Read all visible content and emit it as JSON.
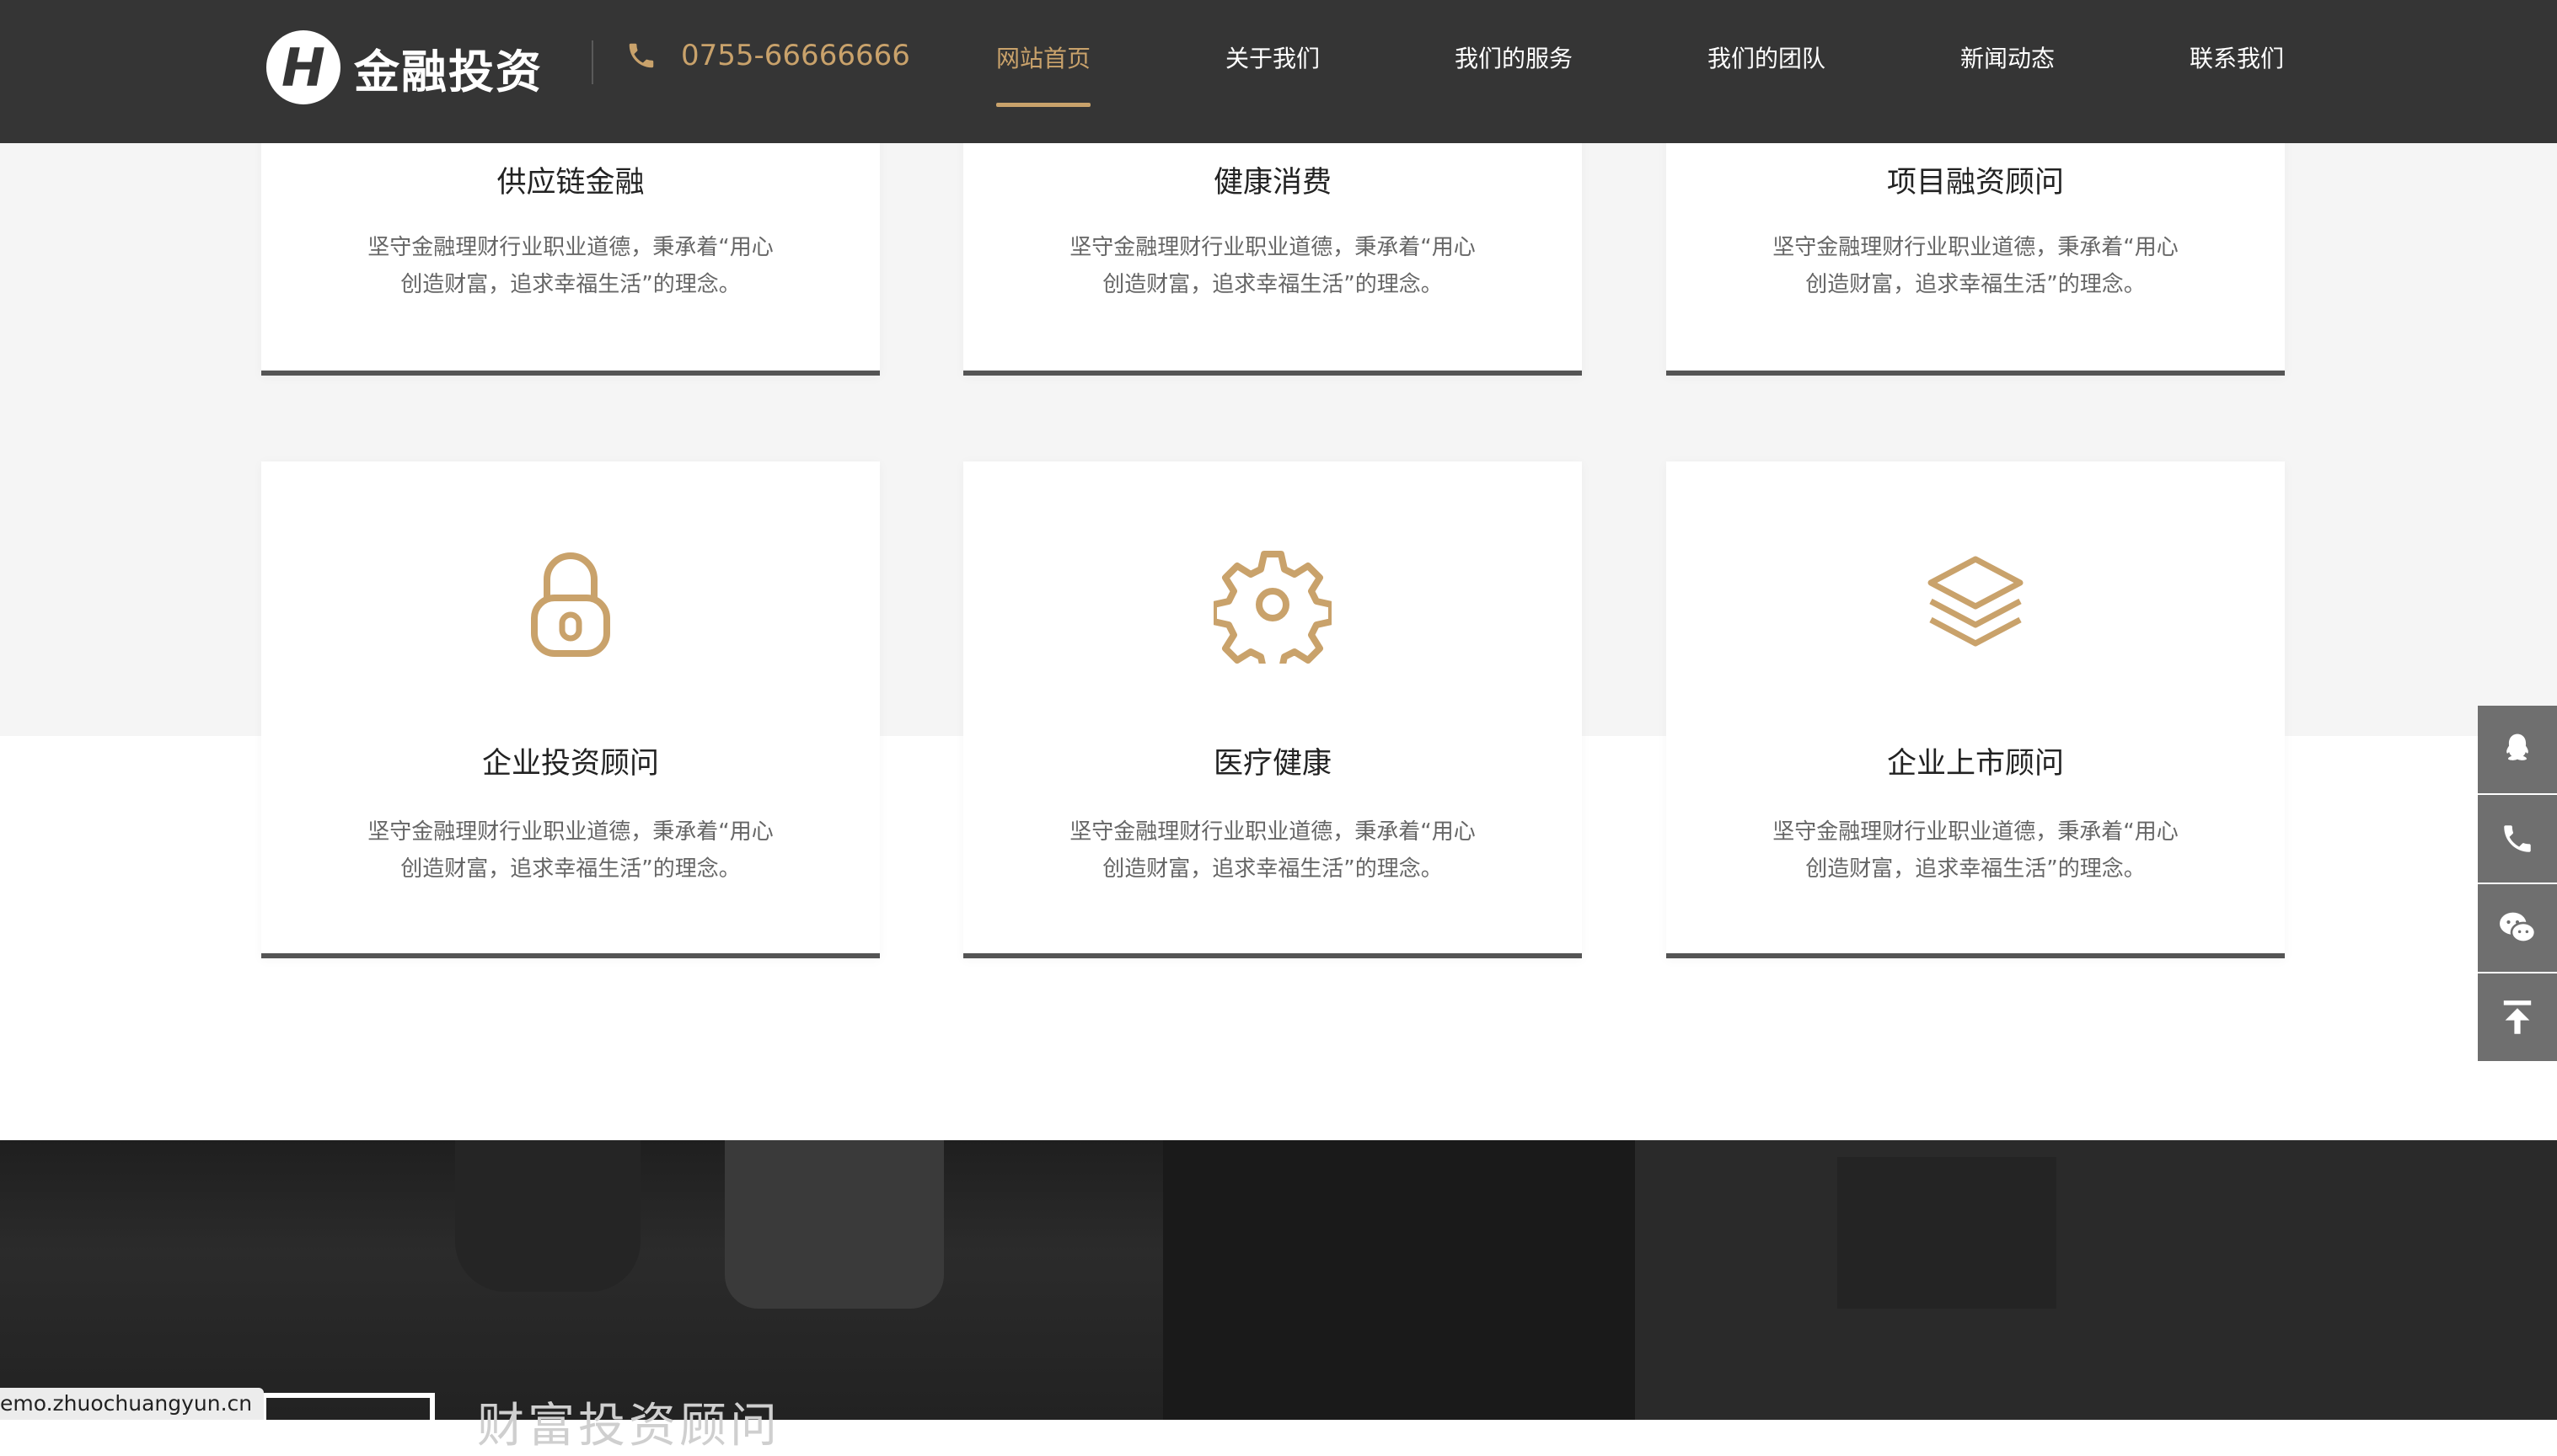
{
  "header": {
    "logo_mark": "H",
    "logo_text": "金融投资",
    "phone": "0755-66666666",
    "nav": [
      {
        "label": "网站首页",
        "active": true
      },
      {
        "label": "关于我们",
        "active": false
      },
      {
        "label": "我们的服务",
        "active": false
      },
      {
        "label": "我们的团队",
        "active": false
      },
      {
        "label": "新闻动态",
        "active": false
      },
      {
        "label": "联系我们",
        "active": false
      }
    ]
  },
  "services": [
    {
      "title": "供应链金融",
      "desc_line1": "坚守金融理财行业职业道德，秉承着“用心",
      "desc_line2": "创造财富，追求幸福生活”的理念。"
    },
    {
      "title": "健康消费",
      "desc_line1": "坚守金融理财行业职业道德，秉承着“用心",
      "desc_line2": "创造财富，追求幸福生活”的理念。"
    },
    {
      "title": "项目融资顾问",
      "desc_line1": "坚守金融理财行业职业道德，秉承着“用心",
      "desc_line2": "创造财富，追求幸福生活”的理念。"
    },
    {
      "title": "企业投资顾问",
      "icon": "lock-icon",
      "desc_line1": "坚守金融理财行业职业道德，秉承着“用心",
      "desc_line2": "创造财富，追求幸福生活”的理念。"
    },
    {
      "title": "医疗健康",
      "icon": "gear-icon",
      "desc_line1": "坚守金融理财行业职业道德，秉承着“用心",
      "desc_line2": "创造财富，追求幸福生活”的理念。"
    },
    {
      "title": "企业上市顾问",
      "icon": "layers-icon",
      "desc_line1": "坚守金融理财行业职业道德，秉承着“用心",
      "desc_line2": "创造财富，追求幸福生活”的理念。"
    }
  ],
  "float_tools": [
    "qq-icon",
    "phone-icon",
    "wechat-icon",
    "back-to-top-icon"
  ],
  "bottom": {
    "section_title": "财富投资顾问",
    "status_url": "emo.zhuochuangyun.cn"
  },
  "colors": {
    "accent": "#c9a26b",
    "header_bg": "#353535",
    "card_border": "#555555"
  }
}
